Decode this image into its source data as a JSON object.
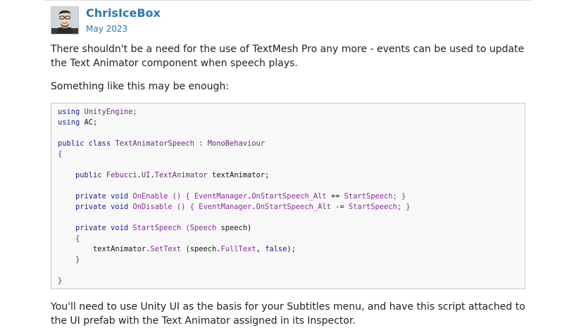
{
  "post": {
    "author": "ChrisIceBox",
    "date": "May 2023",
    "paragraph_1": "There shouldn't be a need for the use of TextMesh Pro any more - events can be used to update the Text Animator component when speech plays.",
    "paragraph_2": "Something like this may be enough:",
    "paragraph_3": "You'll need to use Unity UI as the basis for your Subtitles menu, and have this script attached to the UI prefab with the Text Animator assigned in its Inspector."
  },
  "code_lines": [
    [
      {
        "t": "using",
        "c": "kw"
      },
      {
        "t": " UnityEngine;",
        "c": "ty"
      }
    ],
    [
      {
        "t": "using",
        "c": "kw"
      },
      {
        "t": " AC;",
        "c": "pl"
      }
    ],
    [],
    [
      {
        "t": "public class",
        "c": "kw"
      },
      {
        "t": " TextAnimatorSpeech : MonoBehaviour",
        "c": "ty"
      }
    ],
    [
      {
        "t": "{",
        "c": "ty"
      }
    ],
    [],
    [
      {
        "t": "    public",
        "c": "kw"
      },
      {
        "t": " Febucci",
        "c": "ty"
      },
      {
        "t": ".",
        "c": "pl"
      },
      {
        "t": "UI",
        "c": "ty"
      },
      {
        "t": ".",
        "c": "pl"
      },
      {
        "t": "TextAnimator",
        "c": "ty"
      },
      {
        "t": " textAnimator;",
        "c": "pl"
      }
    ],
    [],
    [
      {
        "t": "    private void",
        "c": "kw"
      },
      {
        "t": " OnEnable () { EventManager",
        "c": "me"
      },
      {
        "t": ".",
        "c": "pl"
      },
      {
        "t": "OnStartSpeech_Alt",
        "c": "me"
      },
      {
        "t": " += ",
        "c": "pl"
      },
      {
        "t": "StartSpeech; }",
        "c": "me"
      }
    ],
    [
      {
        "t": "    private void",
        "c": "kw"
      },
      {
        "t": " OnDisable () { EventManager",
        "c": "me"
      },
      {
        "t": ".",
        "c": "pl"
      },
      {
        "t": "OnStartSpeech_Alt",
        "c": "me"
      },
      {
        "t": " -= ",
        "c": "pl"
      },
      {
        "t": "StartSpeech; }",
        "c": "me"
      }
    ],
    [],
    [
      {
        "t": "    private void",
        "c": "kw"
      },
      {
        "t": " StartSpeech (Speech",
        "c": "me"
      },
      {
        "t": " speech)",
        "c": "pl"
      }
    ],
    [
      {
        "t": "    {",
        "c": "ty"
      }
    ],
    [
      {
        "t": "        textAnimator",
        "c": "pl"
      },
      {
        "t": ".",
        "c": "pl"
      },
      {
        "t": "SetText",
        "c": "me"
      },
      {
        "t": " (speech",
        "c": "pl"
      },
      {
        "t": ".",
        "c": "pl"
      },
      {
        "t": "FullText",
        "c": "me"
      },
      {
        "t": ", ",
        "c": "pl"
      },
      {
        "t": "false",
        "c": "kw"
      },
      {
        "t": ");",
        "c": "pl"
      }
    ],
    [
      {
        "t": "    }",
        "c": "ty"
      }
    ],
    [],
    [
      {
        "t": "}",
        "c": "ty"
      }
    ]
  ],
  "colors": {
    "link": "#2a7ab0",
    "code_keyword": "#1b1b8f",
    "code_type": "#6a2a7a",
    "code_member": "#8a2a9a",
    "code_background": "#f8f8f8"
  }
}
